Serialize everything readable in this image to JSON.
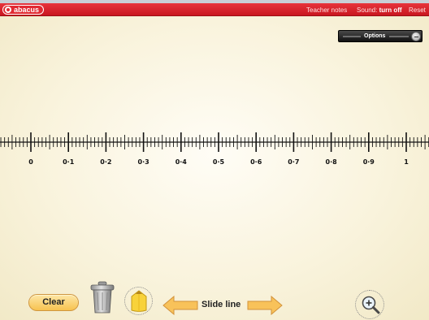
{
  "header": {
    "logo_text": "abacus",
    "teacher_notes": "Teacher notes",
    "sound_label": "Sound:",
    "sound_action": "turn off",
    "reset": "Reset"
  },
  "options": {
    "label": "Options"
  },
  "number_line": {
    "labels": [
      "0",
      "0·1",
      "0·2",
      "0·3",
      "0·4",
      "0·5",
      "0·6",
      "0·7",
      "0·8",
      "0·9",
      "1"
    ],
    "minor_divisions": 10
  },
  "controls": {
    "clear_label": "Clear",
    "slide_label": "Slide line"
  },
  "icons": {
    "logo": "abacus-logo",
    "options_toggle": "minus-icon",
    "trash": "trash-can-icon",
    "pencil": "pencil-icon",
    "slide_left": "arrow-left-icon",
    "slide_right": "arrow-right-icon",
    "zoom": "zoom-in-icon"
  },
  "colors": {
    "header_red": "#d4212a",
    "accent_orange": "#f7c250",
    "background": "#fbf6e4",
    "pencil_yellow": "#f8d23a"
  }
}
